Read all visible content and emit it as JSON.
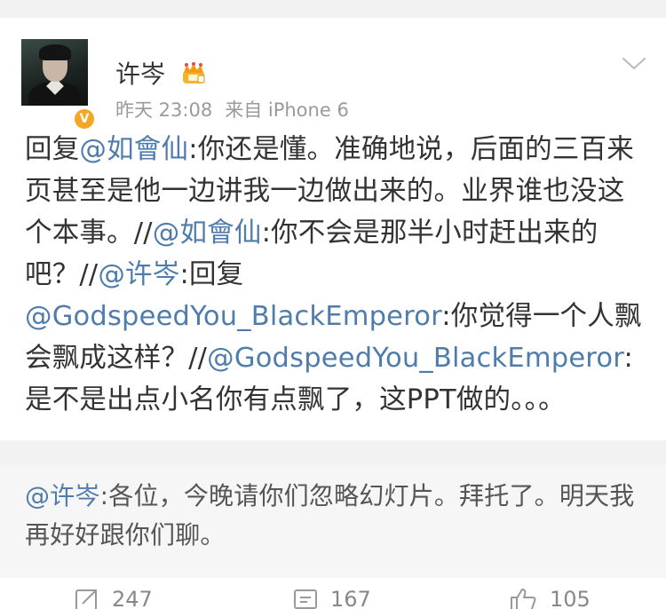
{
  "post": {
    "author": "许岑",
    "time": "昨天 23:08",
    "source": "来自 iPhone 6",
    "verified_badge": "V",
    "text": [
      {
        "t": "回复",
        "m": false
      },
      {
        "t": "@如會仙",
        "m": true
      },
      {
        "t": ":你还是懂。准确地说，后面的三百来页甚至是他一边讲我一边做出来的。业界谁也没这个本事。//",
        "m": false
      },
      {
        "t": "@如會仙",
        "m": true
      },
      {
        "t": ":你不会是那半小时赶出来的吧？//",
        "m": false
      },
      {
        "t": "@许岑",
        "m": true
      },
      {
        "t": ":回复",
        "m": false
      },
      {
        "t": "@GodspeedYou_BlackEmperor",
        "m": true
      },
      {
        "t": ":你觉得一个人飘会飘成这样？//",
        "m": false
      },
      {
        "t": "@GodspeedYou_BlackEmperor",
        "m": true
      },
      {
        "t": ":是不是出点小名你有点飘了，这PPT做的。。。",
        "m": false
      }
    ]
  },
  "repost": {
    "mention": "@许岑",
    "text": ":各位，今晚请你们忽略幻灯片。拜托了。明天我再好好跟你们聊。"
  },
  "actions": {
    "repost_count": "247",
    "comment_count": "167",
    "like_count": "105"
  },
  "icons": {
    "crown": "crown-badge-icon",
    "chevron": "chevron-down-icon",
    "repost": "repost-icon",
    "comment": "comment-icon",
    "like": "thumbs-up-icon"
  },
  "colors": {
    "mention": "#4f7cad",
    "badge": "#f6a623"
  }
}
